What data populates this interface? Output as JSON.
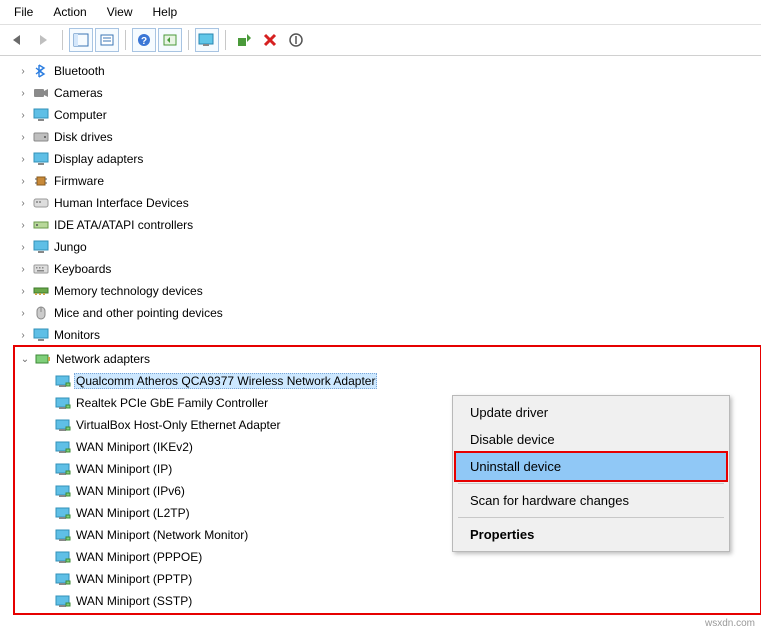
{
  "menu": {
    "file": "File",
    "action": "Action",
    "view": "View",
    "help": "Help"
  },
  "toolbar_icons": {
    "back": "back-arrow",
    "forward": "forward-arrow",
    "props": "properties",
    "grid": "grid-pane",
    "help": "help",
    "refresh": "refresh",
    "monitor": "scan-monitor",
    "install": "install",
    "remove": "remove",
    "update": "update"
  },
  "tree": {
    "items": [
      {
        "label": "Bluetooth",
        "icon": "bluetooth"
      },
      {
        "label": "Cameras",
        "icon": "camera"
      },
      {
        "label": "Computer",
        "icon": "monitor"
      },
      {
        "label": "Disk drives",
        "icon": "disk"
      },
      {
        "label": "Display adapters",
        "icon": "monitor"
      },
      {
        "label": "Firmware",
        "icon": "chip"
      },
      {
        "label": "Human Interface Devices",
        "icon": "hid"
      },
      {
        "label": "IDE ATA/ATAPI controllers",
        "icon": "storage"
      },
      {
        "label": "Jungo",
        "icon": "monitor"
      },
      {
        "label": "Keyboards",
        "icon": "keyboard"
      },
      {
        "label": "Memory technology devices",
        "icon": "memory"
      },
      {
        "label": "Mice and other pointing devices",
        "icon": "mouse"
      },
      {
        "label": "Monitors",
        "icon": "monitor"
      }
    ],
    "network": {
      "label": "Network adapters",
      "icon": "nic",
      "expanded": true,
      "children": [
        {
          "label": "Qualcomm Atheros QCA9377 Wireless Network Adapter",
          "selected": true
        },
        {
          "label": "Realtek PCIe GbE Family Controller"
        },
        {
          "label": "VirtualBox Host-Only Ethernet Adapter"
        },
        {
          "label": "WAN Miniport (IKEv2)"
        },
        {
          "label": "WAN Miniport (IP)"
        },
        {
          "label": "WAN Miniport (IPv6)"
        },
        {
          "label": "WAN Miniport (L2TP)"
        },
        {
          "label": "WAN Miniport (Network Monitor)"
        },
        {
          "label": "WAN Miniport (PPPOE)"
        },
        {
          "label": "WAN Miniport (PPTP)"
        },
        {
          "label": "WAN Miniport (SSTP)"
        }
      ]
    }
  },
  "context_menu": {
    "update": "Update driver",
    "disable": "Disable device",
    "uninstall": "Uninstall device",
    "scan": "Scan for hardware changes",
    "properties": "Properties"
  },
  "footer": "wsxdn.com"
}
